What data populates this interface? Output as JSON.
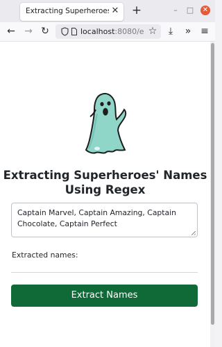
{
  "browser": {
    "tab_title": "Extracting Superheroes' Nan",
    "tab_close_glyph": "✕",
    "new_tab_glyph": "+",
    "url_host": "localhost",
    "url_rest": ":8080/e",
    "minimize_glyph": "–",
    "maximize_glyph": "□",
    "close_glyph": "✕",
    "back_glyph": "←",
    "forward_glyph": "→",
    "reload_glyph": "↻",
    "overflow_glyph": "»",
    "menu_glyph": "≡",
    "download_glyph": "⤓",
    "star_glyph": "☆"
  },
  "page": {
    "title": "Extracting Superheroes' Names Using Regex",
    "input_value": "Captain Marvel, Captain Amazing, Captain Chocolate, Captain Perfect",
    "output_label": "Extracted names:",
    "button_label": "Extract Names"
  },
  "colors": {
    "button_bg": "#0f6a37",
    "ghost_fill": "#8fd6c8",
    "close_button": "#e35b3b"
  }
}
